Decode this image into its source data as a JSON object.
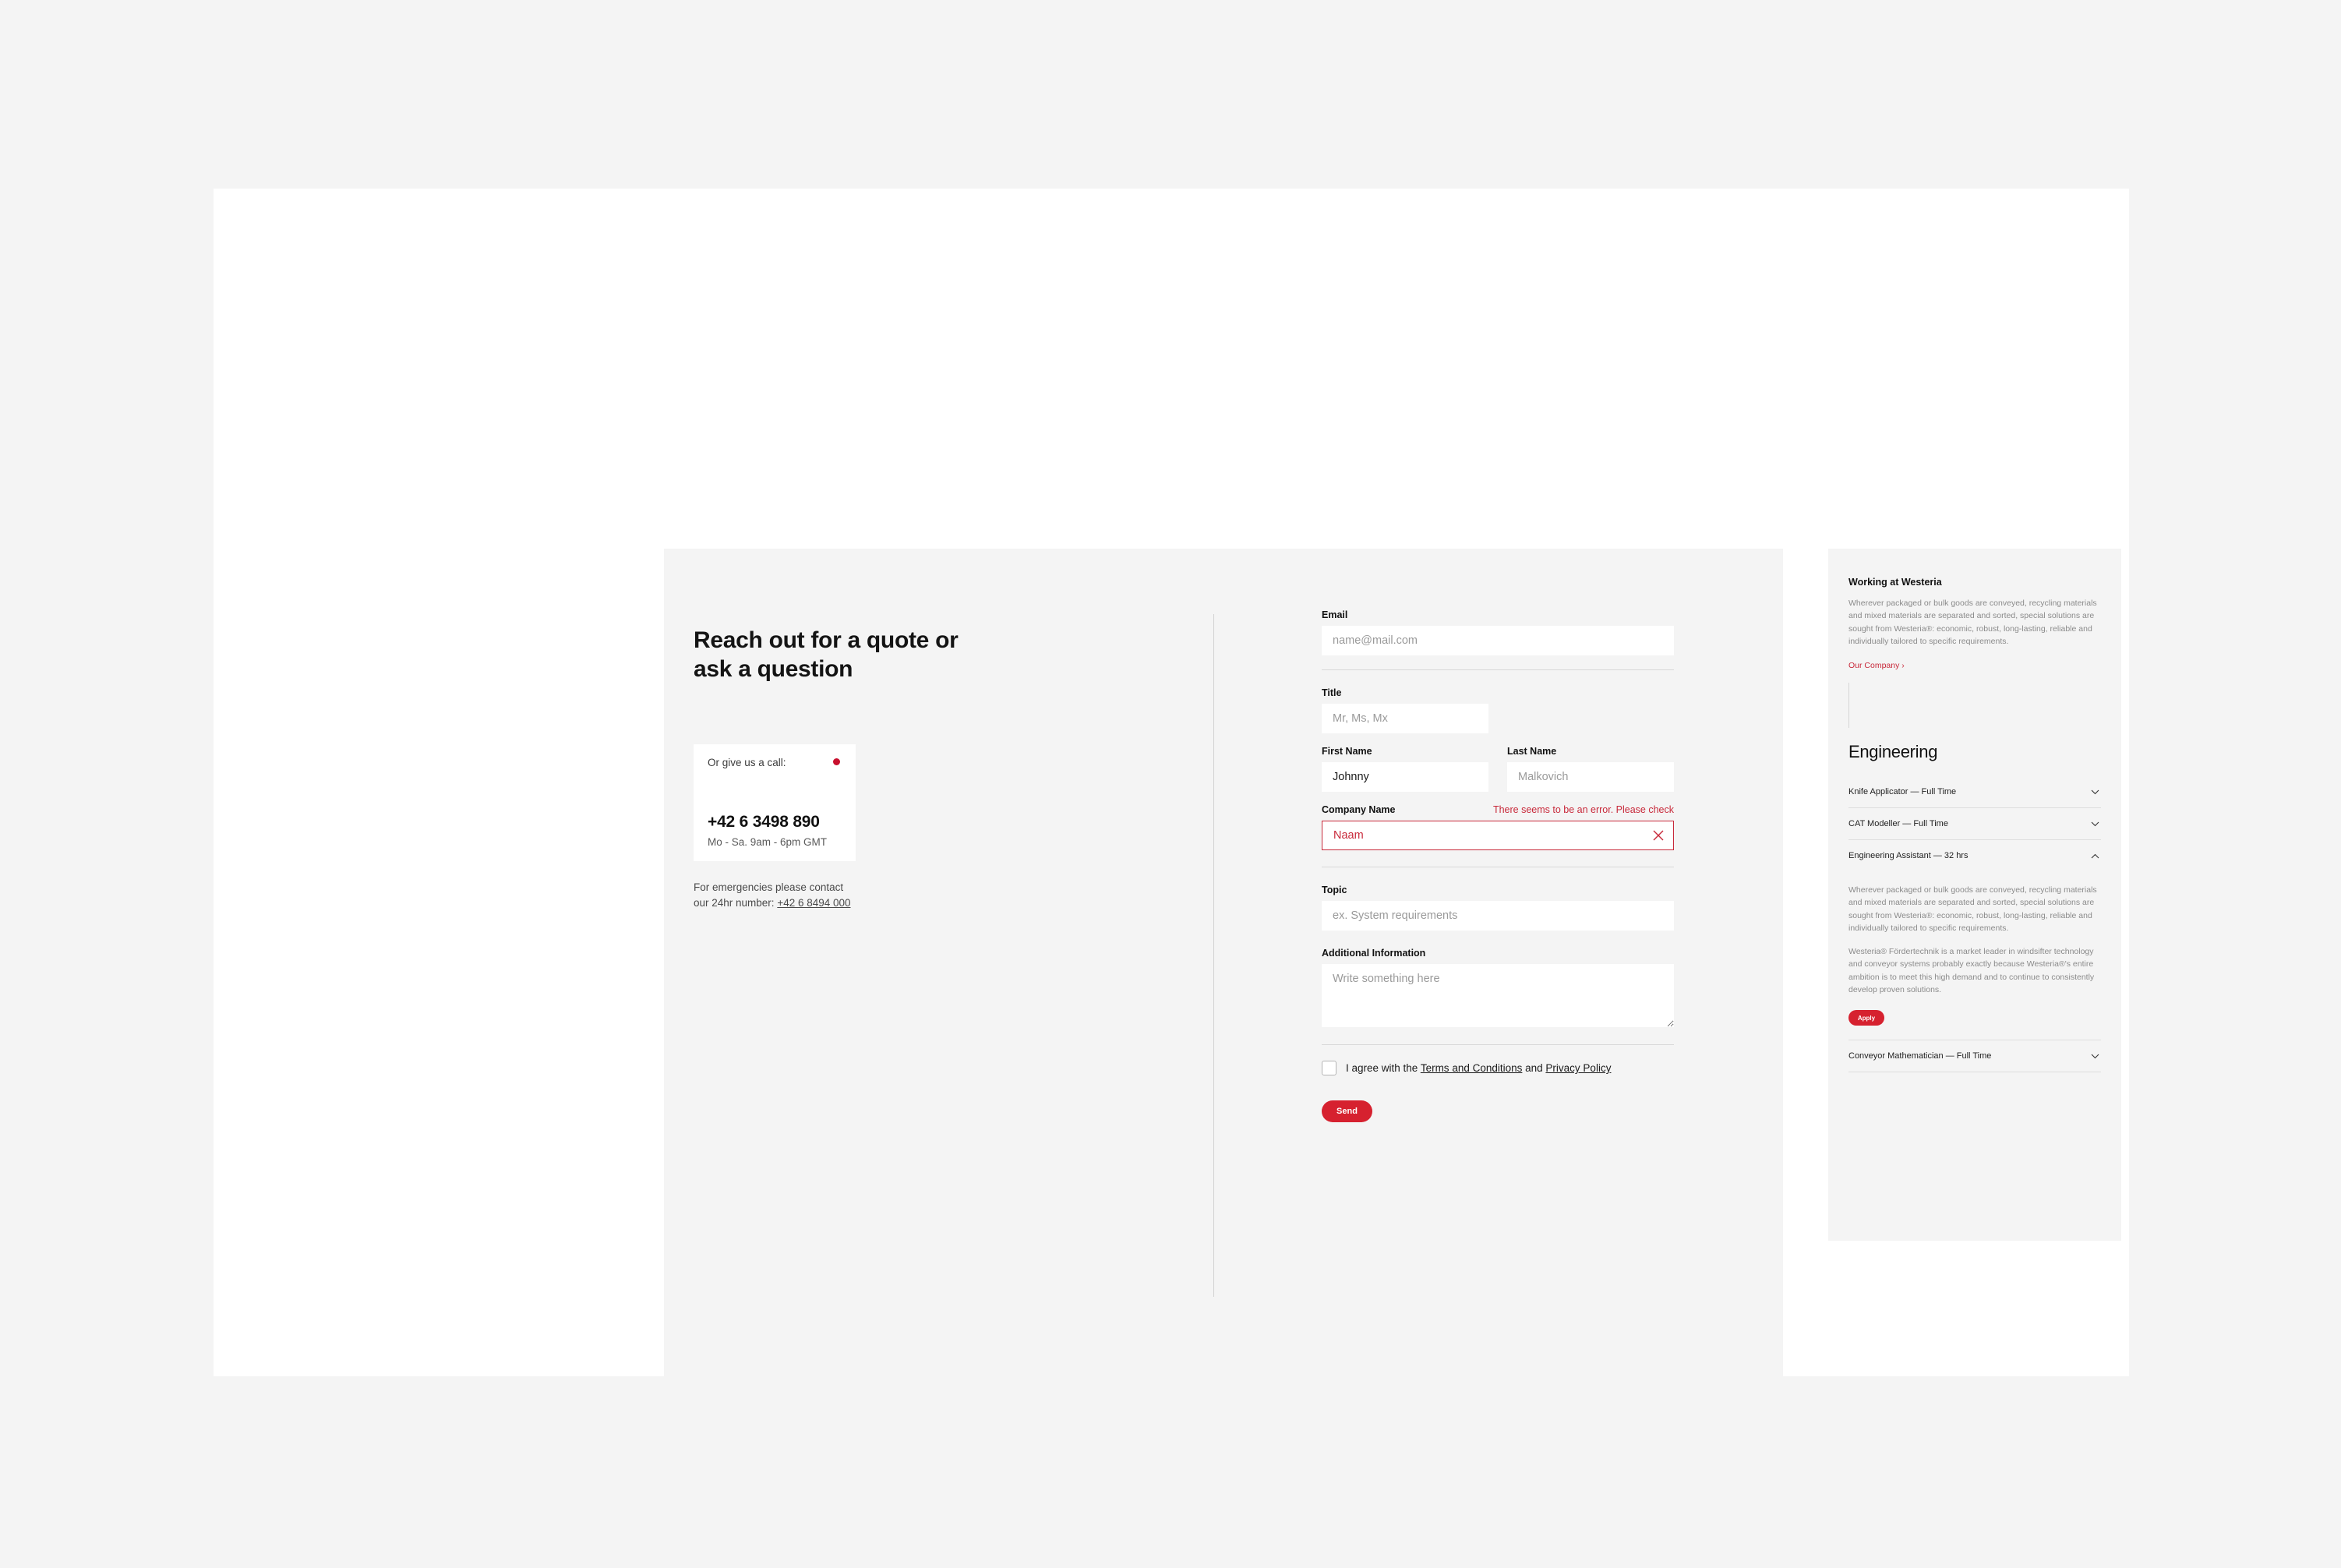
{
  "theme": {
    "accent_red": "#d6212f",
    "error_red": "#c8293a",
    "panel_gray": "#f4f4f4",
    "page_white": "#ffffff"
  },
  "left": {
    "heading": "Reach out for a quote or ask a question",
    "call_card": {
      "label": "Or give us a call:",
      "status_dot": "status-dot",
      "phone": "+42 6 3498 890",
      "hours": "Mo - Sa. 9am - 6pm GMT"
    },
    "emergency": {
      "line1": "For emergencies please contact",
      "line2_prefix": "our 24hr number: ",
      "link": "+42 6 8494 000"
    }
  },
  "form": {
    "email": {
      "label": "Email",
      "value": "",
      "placeholder": "name@mail.com"
    },
    "title": {
      "label": "Title",
      "value": "",
      "placeholder": "Mr, Ms, Mx"
    },
    "first_name": {
      "label": "First Name",
      "value": "Johnny",
      "placeholder": ""
    },
    "last_name": {
      "label": "Last Name",
      "value": "",
      "placeholder": "Malkovich"
    },
    "company": {
      "label": "Company Name",
      "value": "Naam",
      "placeholder": "",
      "error": "There seems to be an error. Please check",
      "clear_icon": "close-icon"
    },
    "topic": {
      "label": "Topic",
      "value": "",
      "placeholder": "ex. System requirements"
    },
    "additional": {
      "label": "Additional Information",
      "value": "",
      "placeholder": "Write something here"
    },
    "consent": {
      "prefix": "I agree with the ",
      "terms_link": "Terms and Conditions",
      "middle": " and ",
      "privacy_link": "Privacy Policy",
      "checked": false
    },
    "submit_label": "Send"
  },
  "sidebar": {
    "heading": "Working at Westeria",
    "intro_paragraph": "Wherever packaged or bulk goods are conveyed, recycling materials and mixed materials are separated and sorted, special solutions are sought from Westeria®: economic, robust, long-lasting, reliable and individually tailored to specific requirements.",
    "company_link": "Our Company",
    "company_link_icon": "chevron-right-icon",
    "section_title": "Engineering",
    "jobs": [
      {
        "title": "Knife Applicator — Full Time",
        "expanded": false,
        "chevron": "chevron-down-icon",
        "paragraphs": [],
        "apply_label": ""
      },
      {
        "title": "CAT Modeller — Full Time",
        "expanded": false,
        "chevron": "chevron-down-icon",
        "paragraphs": [],
        "apply_label": ""
      },
      {
        "title": "Engineering Assistant — 32 hrs",
        "expanded": true,
        "chevron": "chevron-up-icon",
        "paragraphs": [
          "Wherever packaged or bulk goods are conveyed, recycling materials and mixed materials are separated and sorted, special solutions are sought from Westeria®: economic, robust, long-lasting, reliable and individually tailored to specific requirements.",
          "Westeria® Fördertechnik is a market leader in windsifter technology and conveyor systems probably exactly because Westeria®'s entire ambition is to meet this high demand and to continue to consistently develop proven solutions."
        ],
        "apply_label": "Apply"
      },
      {
        "title": "Conveyor Mathematician — Full Time",
        "expanded": false,
        "chevron": "chevron-down-icon",
        "paragraphs": [],
        "apply_label": ""
      }
    ]
  }
}
